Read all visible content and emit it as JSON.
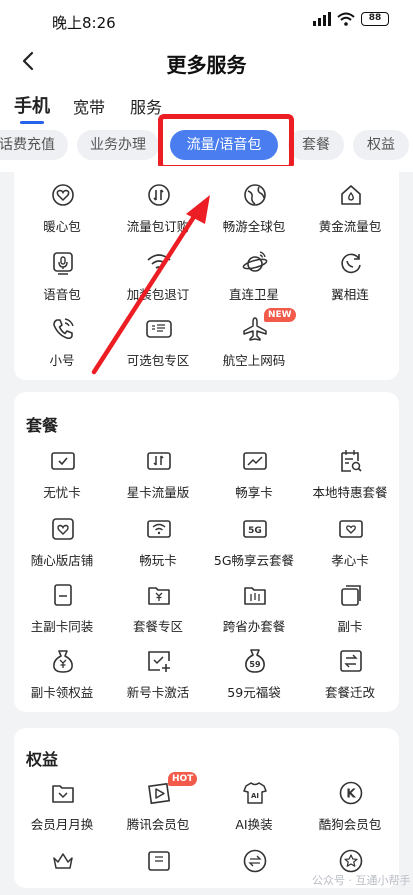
{
  "status": {
    "time": "晚上8:26",
    "battery": "88"
  },
  "header": {
    "title": "更多服务"
  },
  "top_tabs": [
    {
      "label": "手机",
      "active": true
    },
    {
      "label": "宽带",
      "active": false
    },
    {
      "label": "服务",
      "active": false
    }
  ],
  "chips": [
    {
      "label": "话费充值",
      "active": false
    },
    {
      "label": "业务办理",
      "active": false
    },
    {
      "label": "流量/语音包",
      "active": true
    },
    {
      "label": "套餐",
      "active": false
    },
    {
      "label": "权益",
      "active": false
    }
  ],
  "section1": {
    "items": [
      {
        "label": "暖心包",
        "icon": "heart-icon"
      },
      {
        "label": "流量包订购",
        "icon": "data-arrows-icon"
      },
      {
        "label": "畅游全球包",
        "icon": "globe-icon"
      },
      {
        "label": "黄金流量包",
        "icon": "home-drop-icon"
      },
      {
        "label": "语音包",
        "icon": "microphone-icon"
      },
      {
        "label": "加装包退订",
        "icon": "wifi-icon"
      },
      {
        "label": "直连卫星",
        "icon": "satellite-planet-icon"
      },
      {
        "label": "翼相连",
        "icon": "refresh-phone-icon"
      },
      {
        "label": "小号",
        "icon": "phone-call-icon"
      },
      {
        "label": "可选包专区",
        "icon": "optional-tag-icon"
      },
      {
        "label": "航空上网码",
        "icon": "airplane-icon",
        "badge": "NEW"
      }
    ]
  },
  "section2": {
    "title": "套餐",
    "items": [
      {
        "label": "无忧卡",
        "icon": "check-card-icon"
      },
      {
        "label": "星卡流量版",
        "icon": "data-card-icon"
      },
      {
        "label": "畅享卡",
        "icon": "chart-card-icon"
      },
      {
        "label": "本地特惠套餐",
        "icon": "calendar-search-icon"
      },
      {
        "label": "随心版店铺",
        "icon": "heart-shop-icon"
      },
      {
        "label": "畅玩卡",
        "icon": "wifi-card-icon"
      },
      {
        "label": "5G畅享云套餐",
        "icon": "5g-card-icon"
      },
      {
        "label": "孝心卡",
        "icon": "heart-card-icon"
      },
      {
        "label": "主副卡同装",
        "icon": "dual-sim-icon"
      },
      {
        "label": "套餐专区",
        "icon": "yen-folder-icon"
      },
      {
        "label": "跨省办套餐",
        "icon": "map-folder-icon"
      },
      {
        "label": "副卡",
        "icon": "stacked-cards-icon"
      },
      {
        "label": "副卡领权益",
        "icon": "money-bag-icon"
      },
      {
        "label": "新号卡激活",
        "icon": "check-plus-icon"
      },
      {
        "label": "59元福袋",
        "icon": "lucky-bag-59-icon"
      },
      {
        "label": "套餐迁改",
        "icon": "swap-card-icon"
      }
    ]
  },
  "section3": {
    "title": "权益",
    "items": [
      {
        "label": "会员月月换",
        "icon": "gift-box-icon"
      },
      {
        "label": "腾讯会员包",
        "icon": "play-icon",
        "badge": "HOT"
      },
      {
        "label": "AI换装",
        "icon": "ai-shirt-icon"
      },
      {
        "label": "酷狗会员包",
        "icon": "k-music-icon"
      }
    ]
  },
  "watermark": "公众号 · 互通小帮手",
  "colors": {
    "accent": "#4a7ef0",
    "highlight": "#ec1e24",
    "badge": "#f25a4a"
  }
}
